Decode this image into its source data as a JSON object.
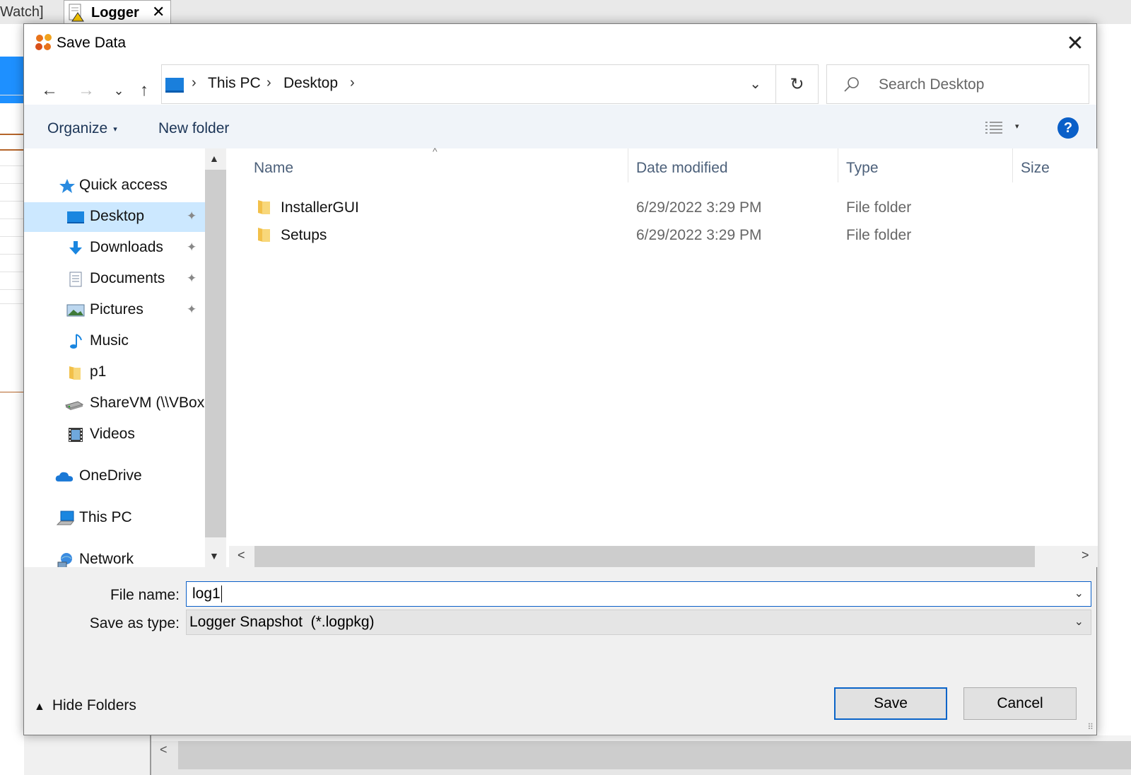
{
  "background": {
    "tab_watch": "Watch]",
    "tab_logger": "Logger",
    "tab_close": "✕",
    "bottom_left_arrow": "<"
  },
  "dialog": {
    "title": "Save Data",
    "close_glyph": "✕"
  },
  "nav": {
    "back": "←",
    "forward": "→",
    "recent": "⌄",
    "up": "↑",
    "path": [
      "This PC",
      "Desktop"
    ],
    "path_chevron": "›",
    "dropdown": "⌄",
    "refresh": "↻",
    "search_placeholder": "Search Desktop"
  },
  "toolbar": {
    "organize": "Organize",
    "organize_caret": "▾",
    "new_folder": "New folder",
    "view_caret": "▾",
    "help": "?"
  },
  "tree": {
    "quick_access": "Quick access",
    "items": [
      {
        "label": "Desktop",
        "icon": "desktop-icon",
        "pinned": true,
        "selected": true
      },
      {
        "label": "Downloads",
        "icon": "downloads-icon",
        "pinned": true
      },
      {
        "label": "Documents",
        "icon": "documents-icon",
        "pinned": true
      },
      {
        "label": "Pictures",
        "icon": "pictures-icon",
        "pinned": true
      },
      {
        "label": "Music",
        "icon": "music-icon"
      },
      {
        "label": "p1",
        "icon": "folder-icon"
      },
      {
        "label": "ShareVM (\\\\VBox",
        "icon": "network-drive-icon"
      },
      {
        "label": "Videos",
        "icon": "videos-icon"
      }
    ],
    "onedrive": "OneDrive",
    "this_pc": "This PC",
    "network": "Network",
    "pin_glyph": "📌",
    "scroll_up": "▲",
    "scroll_down": "▼"
  },
  "files": {
    "columns": {
      "name": "Name",
      "date": "Date modified",
      "type": "Type",
      "size": "Size"
    },
    "sort_glyph": "^",
    "rows": [
      {
        "name": "InstallerGUI",
        "date": "6/29/2022 3:29 PM",
        "type": "File folder"
      },
      {
        "name": "Setups",
        "date": "6/29/2022 3:29 PM",
        "type": "File folder"
      }
    ],
    "scroll_left": "<",
    "scroll_right": ">"
  },
  "form": {
    "file_name_label": "File name:",
    "file_name_value": "log1",
    "save_as_type_label": "Save as type:",
    "save_as_type_value": "Logger Snapshot  (*.logpkg)",
    "dropdown_glyph": "⌄"
  },
  "footer": {
    "hide_folders": "Hide Folders",
    "hide_chevron": "▲",
    "save": "Save",
    "cancel": "Cancel",
    "grip": "⠿"
  },
  "colors": {
    "accent": "#0a5fc8",
    "selection": "#cce8ff",
    "folder": "#f2c04a"
  }
}
